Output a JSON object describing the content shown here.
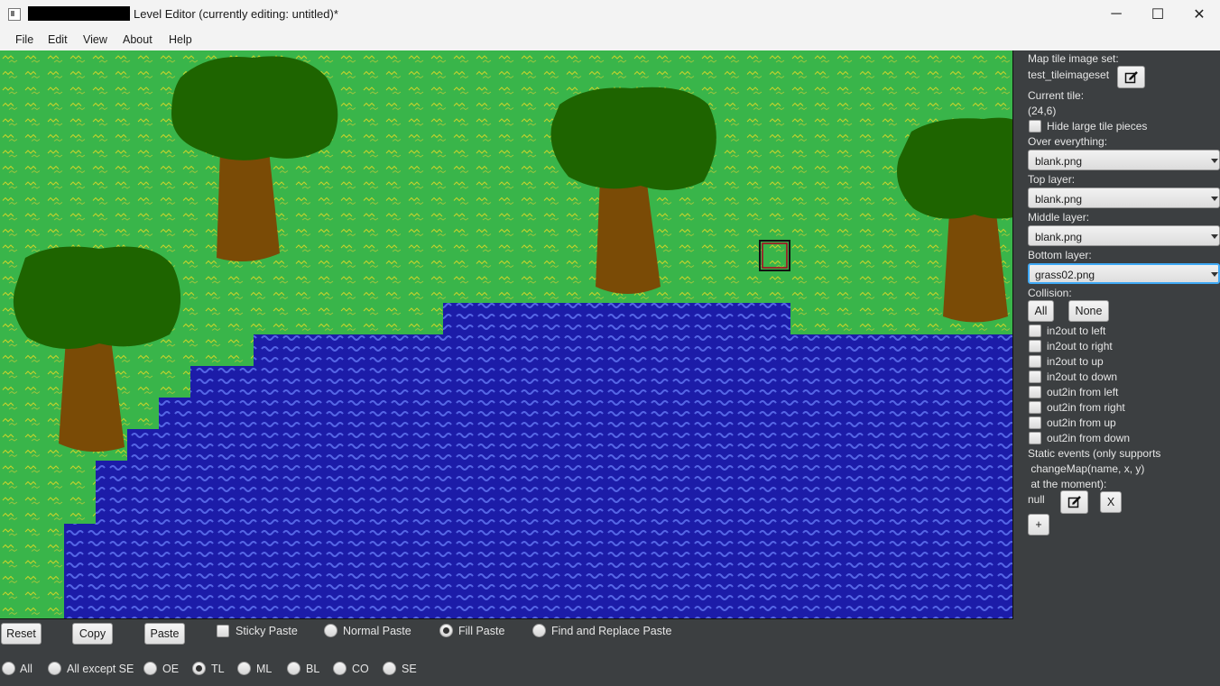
{
  "window": {
    "title": "Level Editor (currently editing: untitled)*",
    "minimize": "─",
    "maximize": "☐",
    "close": "✕"
  },
  "menu": [
    "File",
    "Edit",
    "View",
    "About",
    "Help"
  ],
  "sidebar": {
    "tileset_label": "Map tile image set:",
    "tileset_value": "test_tileimageset",
    "current_tile_label": "Current tile:",
    "current_tile_value": "(24,6)",
    "hide_large_label": "Hide large tile pieces",
    "over_label": "Over everything:",
    "over_value": "blank.png",
    "top_label": "Top layer:",
    "top_value": "blank.png",
    "middle_label": "Middle layer:",
    "middle_value": "blank.png",
    "bottom_label": "Bottom layer:",
    "bottom_value": "grass02.png",
    "collision_label": "Collision:",
    "all_btn": "All",
    "none_btn": "None",
    "collisions": [
      "in2out to left",
      "in2out to right",
      "in2out to up",
      "in2out to down",
      "out2in from left",
      "out2in from right",
      "out2in from up",
      "out2in from down"
    ],
    "events_line1": "Static events (only supports",
    "events_line2": " changeMap(name, x, y)",
    "events_line3": " at the moment):",
    "event_value": "null",
    "remove_btn": "X",
    "add_btn": "+"
  },
  "toolbar": {
    "reset": "Reset",
    "copy": "Copy",
    "paste": "Paste",
    "sticky": "Sticky Paste",
    "normal": "Normal Paste",
    "fill": "Fill Paste",
    "find_replace": "Find and Replace Paste",
    "selected_mode": "Fill Paste"
  },
  "layers": {
    "options": [
      "All",
      "All except SE",
      "OE",
      "TL",
      "ML",
      "BL",
      "CO",
      "SE"
    ],
    "selected": "TL"
  },
  "map": {
    "grass_color": "#39b54a",
    "water_color": "#1c1ca8",
    "tree_foliage_color": "#1e6400",
    "tree_trunk_color": "#7a4b06",
    "selected_tile": "(24,6)"
  }
}
